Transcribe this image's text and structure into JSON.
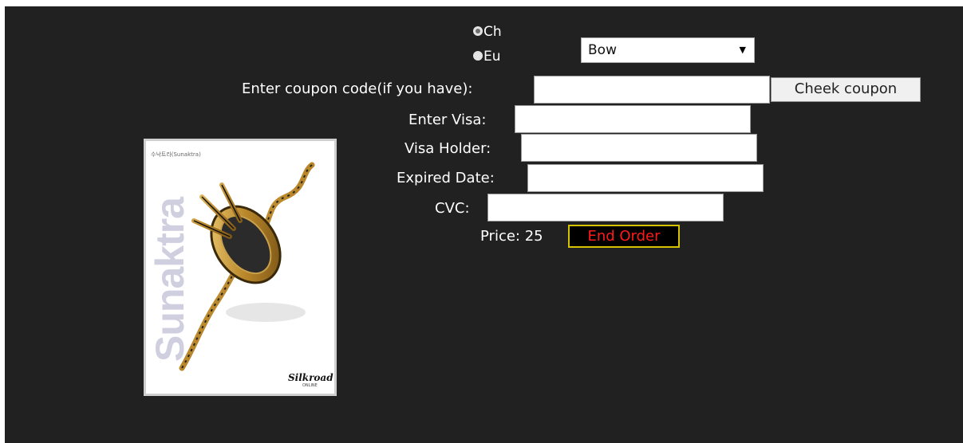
{
  "server_options": [
    {
      "label": "Ch",
      "checked": true
    },
    {
      "label": "Eu",
      "checked": false
    }
  ],
  "item_select": {
    "value": "Bow"
  },
  "coupon": {
    "label": "Enter coupon code(if you have):",
    "value": "",
    "button": "Cheek coupon"
  },
  "visa": {
    "label": "Enter Visa:",
    "value": ""
  },
  "holder": {
    "label": "Visa Holder:",
    "value": ""
  },
  "expired": {
    "label": "Expired Date:",
    "value": ""
  },
  "cvc": {
    "label": "CVC:",
    "value": ""
  },
  "price": {
    "text": "Price: 25"
  },
  "end_order": {
    "label": "End Order"
  },
  "poster": {
    "small_caption": "수낙트라(Sunaktra)",
    "vertical_title": "Sunaktra",
    "logo": "Silkroad",
    "logo_sub": "ONLINE"
  },
  "colors": {
    "background": "#212121",
    "end_order_text": "#ff1a1a",
    "end_order_border": "#d6c400"
  }
}
